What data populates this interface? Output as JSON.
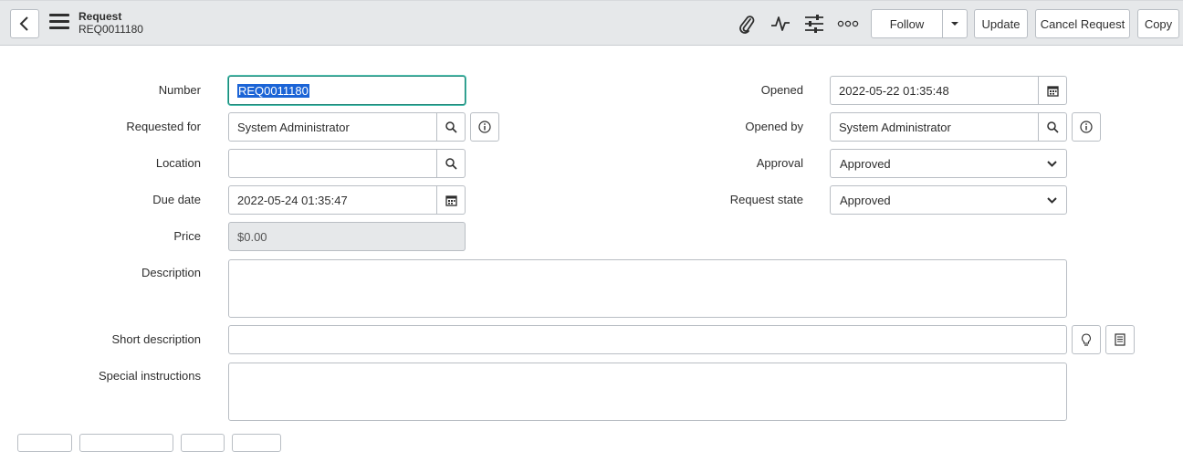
{
  "header": {
    "title": "Request",
    "subtitle": "REQ0011180",
    "buttons": {
      "follow": "Follow",
      "update": "Update",
      "cancel_request": "Cancel Request",
      "copy": "Copy"
    },
    "icons": [
      "paperclip-icon",
      "activity-icon",
      "sliders-icon",
      "more-icon"
    ]
  },
  "form": {
    "number": {
      "label": "Number",
      "value": "REQ0011180"
    },
    "requested_for": {
      "label": "Requested for",
      "value": "System Administrator"
    },
    "location": {
      "label": "Location",
      "value": ""
    },
    "due_date": {
      "label": "Due date",
      "value": "2022-05-24 01:35:47"
    },
    "price": {
      "label": "Price",
      "value": "$0.00"
    },
    "description": {
      "label": "Description",
      "value": ""
    },
    "short_description": {
      "label": "Short description",
      "value": ""
    },
    "special_instructions": {
      "label": "Special instructions",
      "value": ""
    },
    "opened": {
      "label": "Opened",
      "value": "2022-05-22 01:35:48"
    },
    "opened_by": {
      "label": "Opened by",
      "value": "System Administrator"
    },
    "approval": {
      "label": "Approval",
      "value": "Approved"
    },
    "request_state": {
      "label": "Request state",
      "value": "Approved"
    }
  },
  "colors": {
    "header_bg": "#e6e8ea",
    "focus_border": "#1f8476",
    "selection": "#1b64d6"
  }
}
